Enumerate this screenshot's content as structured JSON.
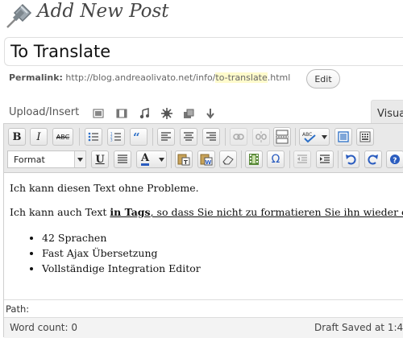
{
  "header": {
    "title": "Add New Post",
    "icon": "pushpin-icon"
  },
  "post": {
    "title_value": "To Translate"
  },
  "permalink": {
    "label": "Permalink:",
    "url_prefix": "http://blog.andreaolivato.net/info/",
    "slug": "to-translate",
    "url_suffix": ".html",
    "edit_label": "Edit"
  },
  "media": {
    "upload_label": "Upload/Insert",
    "icons": [
      "add-image-icon",
      "add-video-icon",
      "add-audio-icon",
      "add-media-icon",
      "add-file-icon",
      "download-icon"
    ]
  },
  "tabs": {
    "visual_label": "Visua"
  },
  "toolbar": {
    "row1": [
      "bold",
      "italic",
      "strikethrough",
      "bullet-list",
      "numbered-list",
      "blockquote",
      "align-left",
      "align-center",
      "align-right",
      "insert-link",
      "unlink",
      "insert-more",
      "spellcheck",
      "fullscreen",
      "kitchen-sink"
    ],
    "bold_label": "B",
    "italic_label": "I",
    "strike_label": "ABC",
    "underline_label": "U",
    "text_color_label": "A",
    "omega_label": "Ω",
    "format_selected": "Format"
  },
  "content": {
    "paragraph1": "Ich kann diesen Text ohne Probleme.",
    "paragraph2_before": "Ich kann auch Text ",
    "paragraph2_bold": "in Tags",
    "paragraph2_after": ", so dass Sie nicht zu formatieren Sie ihn wieder ein.",
    "list": [
      "42 Sprachen",
      "Fast Ajax Übersetzung",
      "Vollständige Integration Editor"
    ]
  },
  "path": {
    "label": "Path:"
  },
  "status": {
    "word_count": "Word count: 0",
    "draft": "Draft Saved at 1:4"
  },
  "colors": {
    "accent_blue": "#21759b",
    "toolbar_bg": "#e9e9e9",
    "slug_highlight": "#fffbcc"
  }
}
